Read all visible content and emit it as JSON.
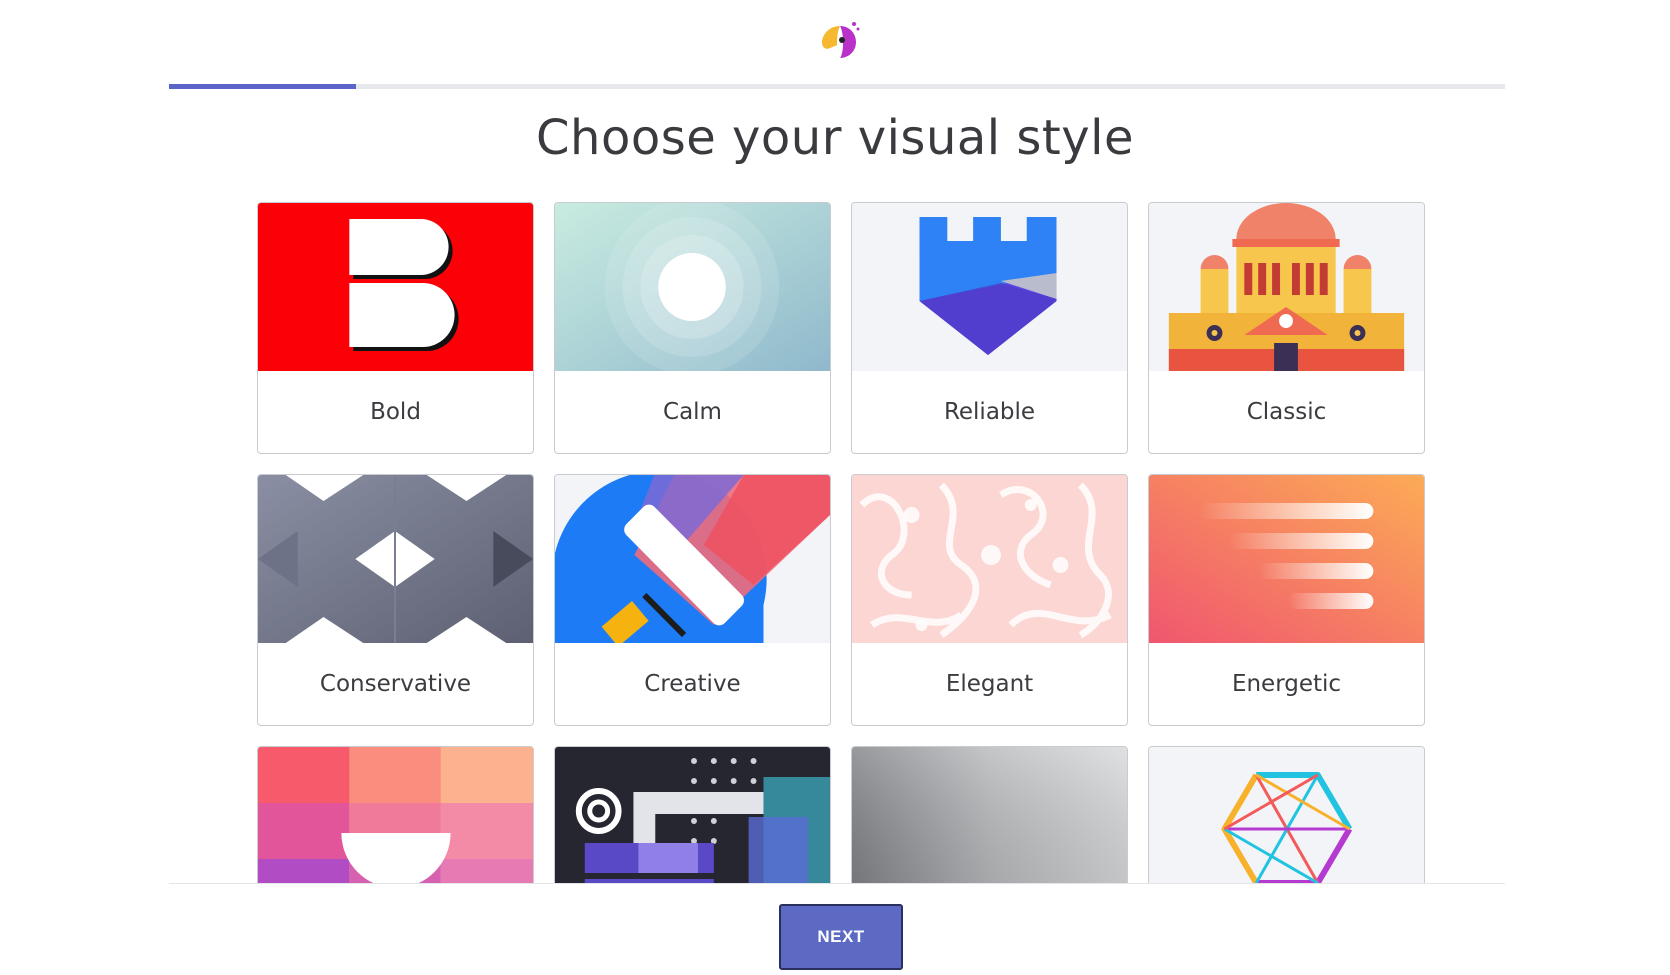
{
  "header": {
    "logo_icon": "parrot-logo-icon",
    "progress_fraction": 0.14
  },
  "page": {
    "title": "Choose your visual style"
  },
  "styles": [
    {
      "label": "Bold",
      "icon": "bold-b-icon"
    },
    {
      "label": "Calm",
      "icon": "calm-circles-icon"
    },
    {
      "label": "Reliable",
      "icon": "castle-shield-icon"
    },
    {
      "label": "Classic",
      "icon": "classic-building-icon"
    },
    {
      "label": "Conservative",
      "icon": "geometric-diamond-icon"
    },
    {
      "label": "Creative",
      "icon": "paint-roller-icon"
    },
    {
      "label": "Elegant",
      "icon": "damask-pattern-icon"
    },
    {
      "label": "Energetic",
      "icon": "speed-lines-icon"
    },
    {
      "label": "",
      "icon": "pastel-blocks-icon"
    },
    {
      "label": "",
      "icon": "tech-grid-icon"
    },
    {
      "label": "",
      "icon": "metallic-gradient-icon"
    },
    {
      "label": "",
      "icon": "hexagon-wireframe-icon"
    }
  ],
  "footer": {
    "next_label": "NEXT"
  },
  "colors": {
    "accent": "#5c6ac4",
    "progress": "#5b65c7"
  }
}
